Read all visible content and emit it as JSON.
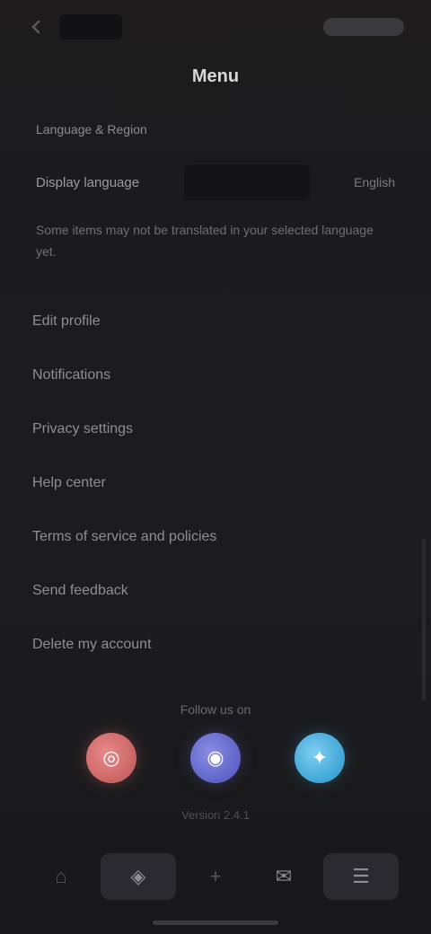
{
  "header": {
    "title": "Menu",
    "back_glyph": "‹",
    "logo_icon": "app-logo-icon"
  },
  "section": {
    "label": "Language & Region"
  },
  "selector": {
    "label": "Display language",
    "value": "English"
  },
  "notice": {
    "text": "Some items may not be translated in your selected language yet."
  },
  "menu": {
    "items": [
      {
        "label": "Edit profile"
      },
      {
        "label": "Notifications"
      },
      {
        "label": "Privacy settings"
      },
      {
        "label": "Help center"
      },
      {
        "label": "Terms of service and policies"
      },
      {
        "label": "Send feedback"
      },
      {
        "label": "Delete my account"
      }
    ]
  },
  "follow": {
    "label": "Follow us on",
    "socials": [
      {
        "name": "instagram-icon",
        "glyph": "◎",
        "color": "#d97777"
      },
      {
        "name": "discord-icon",
        "glyph": "◉",
        "color": "#6f74d6"
      },
      {
        "name": "twitter-icon",
        "glyph": "✦",
        "color": "#4fb2e0"
      }
    ]
  },
  "footer": {
    "version": "Version 2.4.1"
  },
  "bottom_nav": {
    "items": [
      {
        "name": "nav-home",
        "glyph": "⌂"
      },
      {
        "name": "nav-explore",
        "glyph": "◈"
      },
      {
        "name": "nav-create",
        "glyph": "+"
      },
      {
        "name": "nav-inbox",
        "glyph": "✉"
      },
      {
        "name": "nav-menu",
        "glyph": "☰"
      }
    ]
  }
}
